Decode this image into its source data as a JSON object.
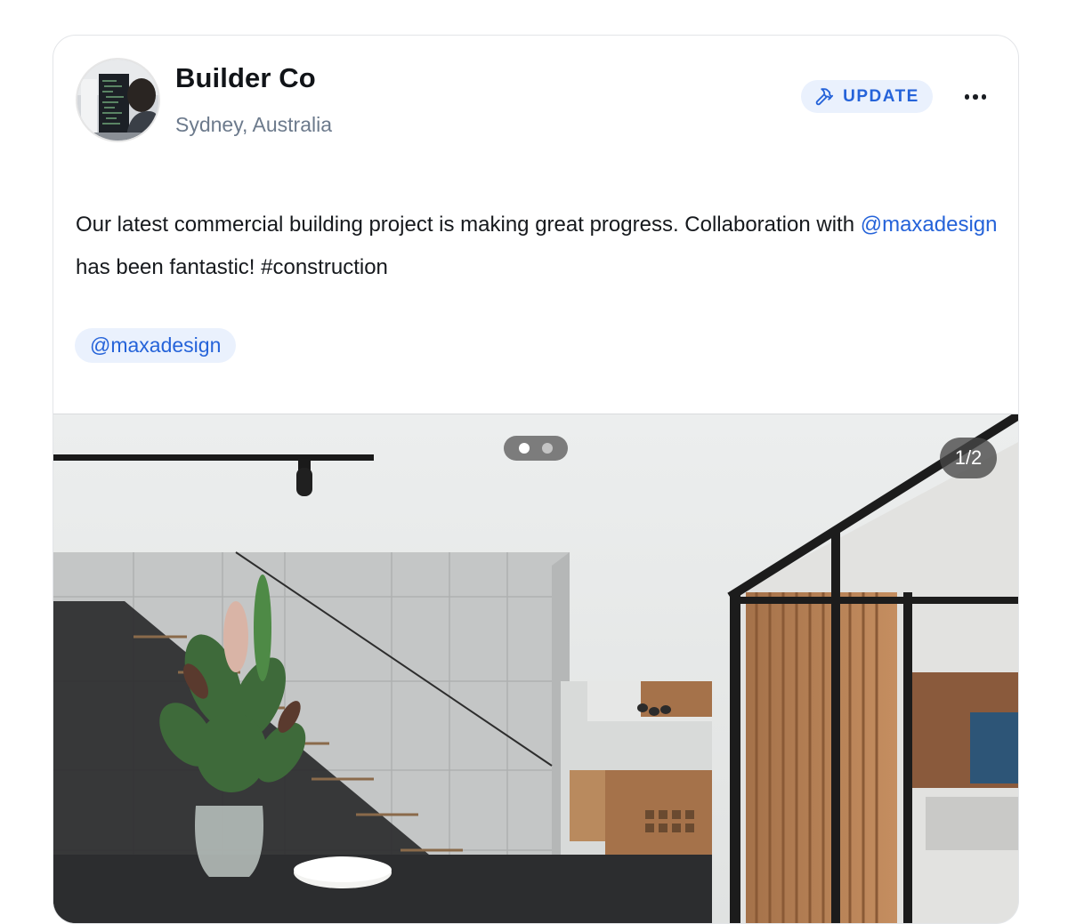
{
  "post": {
    "author_name": "Builder Co",
    "author_location": "Sydney, Australia",
    "avatar_icon": "person-at-computer-avatar",
    "badge": {
      "label": "UPDATE",
      "icon": "hammer-icon",
      "background": "#eaf1fd",
      "color": "#2563d9"
    },
    "more_icon": "more-horizontal-icon",
    "text_before_mention": "Our latest commercial building project is making great progress. Collaboration with ",
    "mention": "@maxadesign",
    "text_after_mention": " has been fantastic! #construction",
    "tags": [
      "@maxadesign"
    ],
    "media": {
      "image_icon": "interior-photo",
      "counter": "1/2",
      "total": 2,
      "current_index": 1
    }
  },
  "colors": {
    "accent": "#2563d9",
    "text": "#16191d",
    "muted": "#6c7a8c",
    "card_border": "#e3e5e8"
  }
}
